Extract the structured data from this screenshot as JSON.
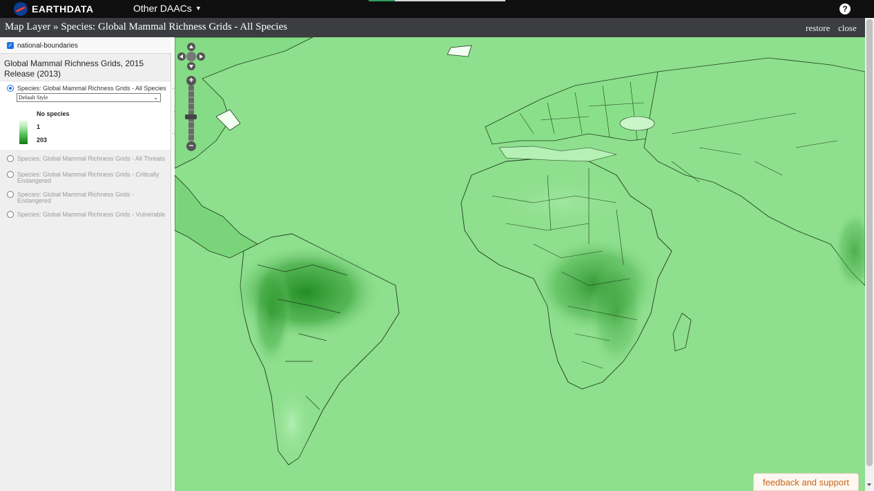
{
  "topbar": {
    "brand": "EARTHDATA",
    "menu_label": "Other DAACs",
    "help_icon": "question-circle-icon"
  },
  "titlebar": {
    "title": "Map Layer » Species: Global Mammal Richness Grids - All Species",
    "restore": "restore",
    "close": "close"
  },
  "sidebar": {
    "boundaries_label": "national-boundaries",
    "boundaries_checked": true,
    "group_title": "Global Mammal Richness Grids, 2015 Release (2013)",
    "active_layer": {
      "label": "Species: Global Mammal Richness Grids - All Species",
      "style_value": "Default Style"
    },
    "legend": {
      "no_species": "No species",
      "min": "1",
      "max": "203",
      "colors": [
        "#e6fae6",
        "#0c7c0c"
      ]
    },
    "other_layers": [
      "Species: Global Mammal Richness Grids - All Threats",
      "Species: Global Mammal Richness Grids - Critically Endangered",
      "Species: Global Mammal Richness Grids - Endangered",
      "Species: Global Mammal Richness Grids - Vulnerable"
    ]
  },
  "map": {
    "land_color": "#8edf8e",
    "rich_color": "#1e8a1e",
    "zoom_in": "+",
    "zoom_out": "−"
  },
  "feedback": "feedback and support"
}
